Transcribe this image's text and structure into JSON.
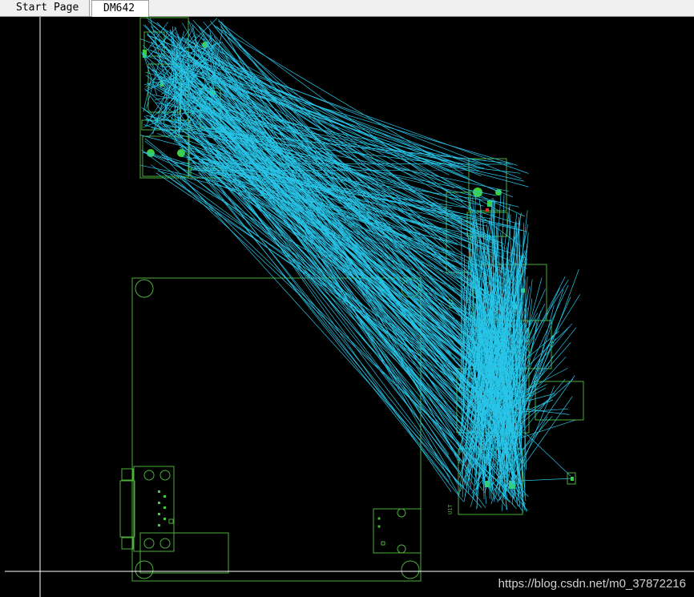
{
  "tabs": [
    {
      "label": "Start Page",
      "active": false
    },
    {
      "label": "DM642",
      "active": true
    }
  ],
  "watermark": "https://blog.csdn.net/m0_37872216",
  "silkscreen": {
    "u1_label_a": "U1T",
    "u1_label_b": "U1T"
  },
  "colors": {
    "background": "#000000",
    "ratsnest": "#29c5e8",
    "outline": "#4caf3c",
    "pad": "#3cd03c",
    "crosshair": "#ffffff",
    "marker": "#e03030"
  },
  "icons": [
    "cursor-crosshair-icon"
  ]
}
